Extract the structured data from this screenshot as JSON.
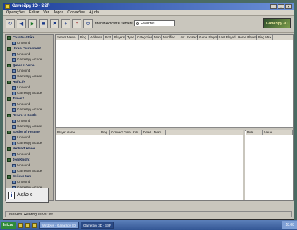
{
  "window": {
    "title": "GameSpy 3D - SSP",
    "controls": [
      "_",
      "□",
      "×"
    ]
  },
  "menu": [
    "Operações",
    "Editar",
    "Ver",
    "Jogos",
    "Conexões",
    "Ajuda"
  ],
  "toolbar": {
    "filter_label": "Ordenar/Amostrar servers",
    "filter_value": "Favoritos",
    "brand": "GameSpy 3D"
  },
  "sidebar": {
    "items": [
      {
        "label": "Counter-Strike",
        "level": 0
      },
      {
        "label": "Unbound",
        "level": 1
      },
      {
        "label": "Unreal Tournament",
        "level": 0
      },
      {
        "label": "Unbound",
        "level": 1
      },
      {
        "label": "GameSpy Arcade",
        "level": 1
      },
      {
        "label": "Quake 3 Arena",
        "level": 0
      },
      {
        "label": "Unbound",
        "level": 1
      },
      {
        "label": "GameSpy Arcade",
        "level": 1
      },
      {
        "label": "Half-Life",
        "level": 0
      },
      {
        "label": "Unbound",
        "level": 1
      },
      {
        "label": "GameSpy Arcade",
        "level": 1
      },
      {
        "label": "Tribes 2",
        "level": 0
      },
      {
        "label": "Unbound",
        "level": 1
      },
      {
        "label": "GameSpy Arcade",
        "level": 1
      },
      {
        "label": "Return to Castle",
        "level": 0
      },
      {
        "label": "Unbound",
        "level": 1
      },
      {
        "label": "GameSpy Arcade",
        "level": 1
      },
      {
        "label": "Soldier of Fortune",
        "level": 0
      },
      {
        "label": "Unbound",
        "level": 1
      },
      {
        "label": "GameSpy Arcade",
        "level": 1
      },
      {
        "label": "Medal of Honor",
        "level": 0
      },
      {
        "label": "Unbound",
        "level": 1
      },
      {
        "label": "Jedi Knight",
        "level": 0
      },
      {
        "label": "Unbound",
        "level": 1
      },
      {
        "label": "GameSpy Arcade",
        "level": 1
      },
      {
        "label": "Serious Sam",
        "level": 0
      },
      {
        "label": "Unbound",
        "level": 1
      },
      {
        "label": "GameSpy Arcade",
        "level": 1
      }
    ]
  },
  "server_columns": [
    "Server Name",
    "Ping",
    "Address",
    "Port",
    "Players",
    "Type",
    "Categories",
    "Map",
    "Modified",
    "Last Updated",
    "Game Players",
    "Last Played",
    "Home Players",
    "Ping Max"
  ],
  "player_columns": [
    "Player Name",
    "Ping",
    "Connect Time",
    "Kills",
    "Dead",
    "Team"
  ],
  "rules_columns": [
    "Rule",
    "Value"
  ],
  "status_text": "0 servers. Reading server list...",
  "toast": {
    "icon_glyph": "i",
    "text": "Ação c"
  },
  "taskbar": {
    "start_label": "Iniciar",
    "buttons": [
      "Windows - GameSpy 3D",
      "GameSpy 3D - SSP"
    ],
    "tray": "18:08"
  }
}
